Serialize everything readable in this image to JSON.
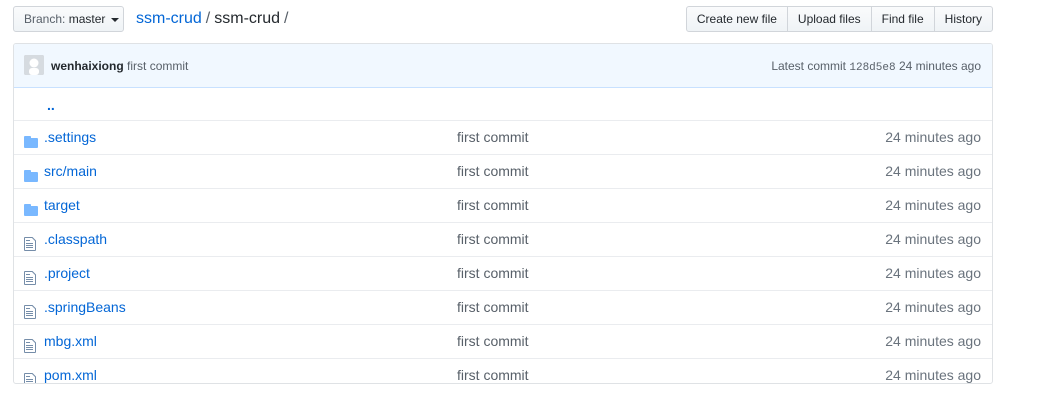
{
  "branch": {
    "prefix": "Branch:",
    "name": "master"
  },
  "breadcrumb": {
    "owner": "ssm-crud",
    "sep1": "/",
    "repo": "ssm-crud",
    "sep2": "/"
  },
  "actions": {
    "create": "Create new file",
    "upload": "Upload files",
    "find": "Find file",
    "history": "History"
  },
  "commit": {
    "author": "wenhaixiong",
    "message": "first commit",
    "latest_label": "Latest commit",
    "sha": "128d5e8",
    "age": "24 minutes ago"
  },
  "parent_dir": "..",
  "files": [
    {
      "name": ".settings",
      "type": "folder",
      "message": "first commit",
      "age": "24 minutes ago"
    },
    {
      "name": "src/main",
      "type": "folder",
      "message": "first commit",
      "age": "24 minutes ago"
    },
    {
      "name": "target",
      "type": "folder",
      "message": "first commit",
      "age": "24 minutes ago"
    },
    {
      "name": ".classpath",
      "type": "file",
      "message": "first commit",
      "age": "24 minutes ago"
    },
    {
      "name": ".project",
      "type": "file",
      "message": "first commit",
      "age": "24 minutes ago"
    },
    {
      "name": ".springBeans",
      "type": "file",
      "message": "first commit",
      "age": "24 minutes ago"
    },
    {
      "name": "mbg.xml",
      "type": "file",
      "message": "first commit",
      "age": "24 minutes ago"
    },
    {
      "name": "pom.xml",
      "type": "file",
      "message": "first commit",
      "age": "24 minutes ago"
    }
  ],
  "icons": {
    "folder": "folder-icon",
    "file": "file-icon",
    "caret": "caret-down-icon",
    "avatar": "avatar-icon"
  },
  "colors": {
    "link": "#0366d6",
    "folder": "#79b8ff",
    "commit_bg": "#f1f8ff"
  }
}
